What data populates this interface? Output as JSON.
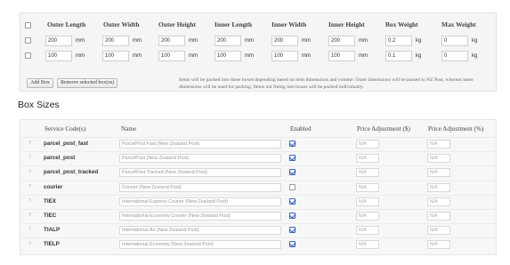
{
  "boxes": {
    "headers": [
      "Outer Length",
      "Outer Width",
      "Outer Height",
      "Inner Length",
      "Inner Width",
      "Inner Height",
      "Box Weight",
      "Max Weight"
    ],
    "rows": [
      {
        "outer_length": "200",
        "outer_width": "200",
        "outer_height": "200",
        "inner_length": "200",
        "inner_width": "200",
        "inner_height": "200",
        "box_weight": "0.2",
        "max_weight": "0"
      },
      {
        "outer_length": "100",
        "outer_width": "100",
        "outer_height": "100",
        "inner_length": "100",
        "inner_width": "100",
        "inner_height": "100",
        "box_weight": "0.1",
        "max_weight": "0"
      }
    ],
    "units": {
      "length": "mm",
      "weight": "kg"
    },
    "add_button": "Add Box",
    "remove_button": "Remove selected box(es)",
    "note": "Items will be packed into these boxes depending based on item dimensions and volume. Outer dimensions will be passed to NZ Post, whereas inner dimensions will be used for packing. Items not fitting into boxes will be packed individually."
  },
  "section_title": "Box Sizes",
  "services": {
    "headers": {
      "code": "Service Code(s)",
      "name": "Name",
      "enabled": "Enabled",
      "adj_dollar": "Price Adjustment ($)",
      "adj_percent": "Price Adjustment (%)"
    },
    "rows": [
      {
        "code": "parcel_post_fast",
        "name": "ParcelPost Fast (New Zealand Post)",
        "enabled": true,
        "adj_dollar": "N/A",
        "adj_percent": "N/A"
      },
      {
        "code": "parcel_post",
        "name": "ParcelPost (New Zealand Post)",
        "enabled": true,
        "adj_dollar": "N/A",
        "adj_percent": "N/A"
      },
      {
        "code": "parcel_post_tracked",
        "name": "ParcelPost Tracked (New Zealand Post)",
        "enabled": true,
        "adj_dollar": "N/A",
        "adj_percent": "N/A"
      },
      {
        "code": "courier",
        "name": "Courier (New Zealand Post)",
        "enabled": false,
        "adj_dollar": "N/A",
        "adj_percent": "N/A"
      },
      {
        "code": "TIEX",
        "name": "International Express Courier (New Zealand Post)",
        "enabled": true,
        "adj_dollar": "N/A",
        "adj_percent": "N/A"
      },
      {
        "code": "TIEC",
        "name": "International Economy Courier (New Zealand Post)",
        "enabled": true,
        "adj_dollar": "N/A",
        "adj_percent": "N/A"
      },
      {
        "code": "TIALP",
        "name": "International Air (New Zealand Post)",
        "enabled": true,
        "adj_dollar": "N/A",
        "adj_percent": "N/A"
      },
      {
        "code": "TIELP",
        "name": "International Economy (New Zealand Post)",
        "enabled": true,
        "adj_dollar": "N/A",
        "adj_percent": "N/A"
      }
    ]
  },
  "colors": {
    "checkbox_checked": "#2a55b0",
    "panel_bg": "#f5f5f5"
  }
}
